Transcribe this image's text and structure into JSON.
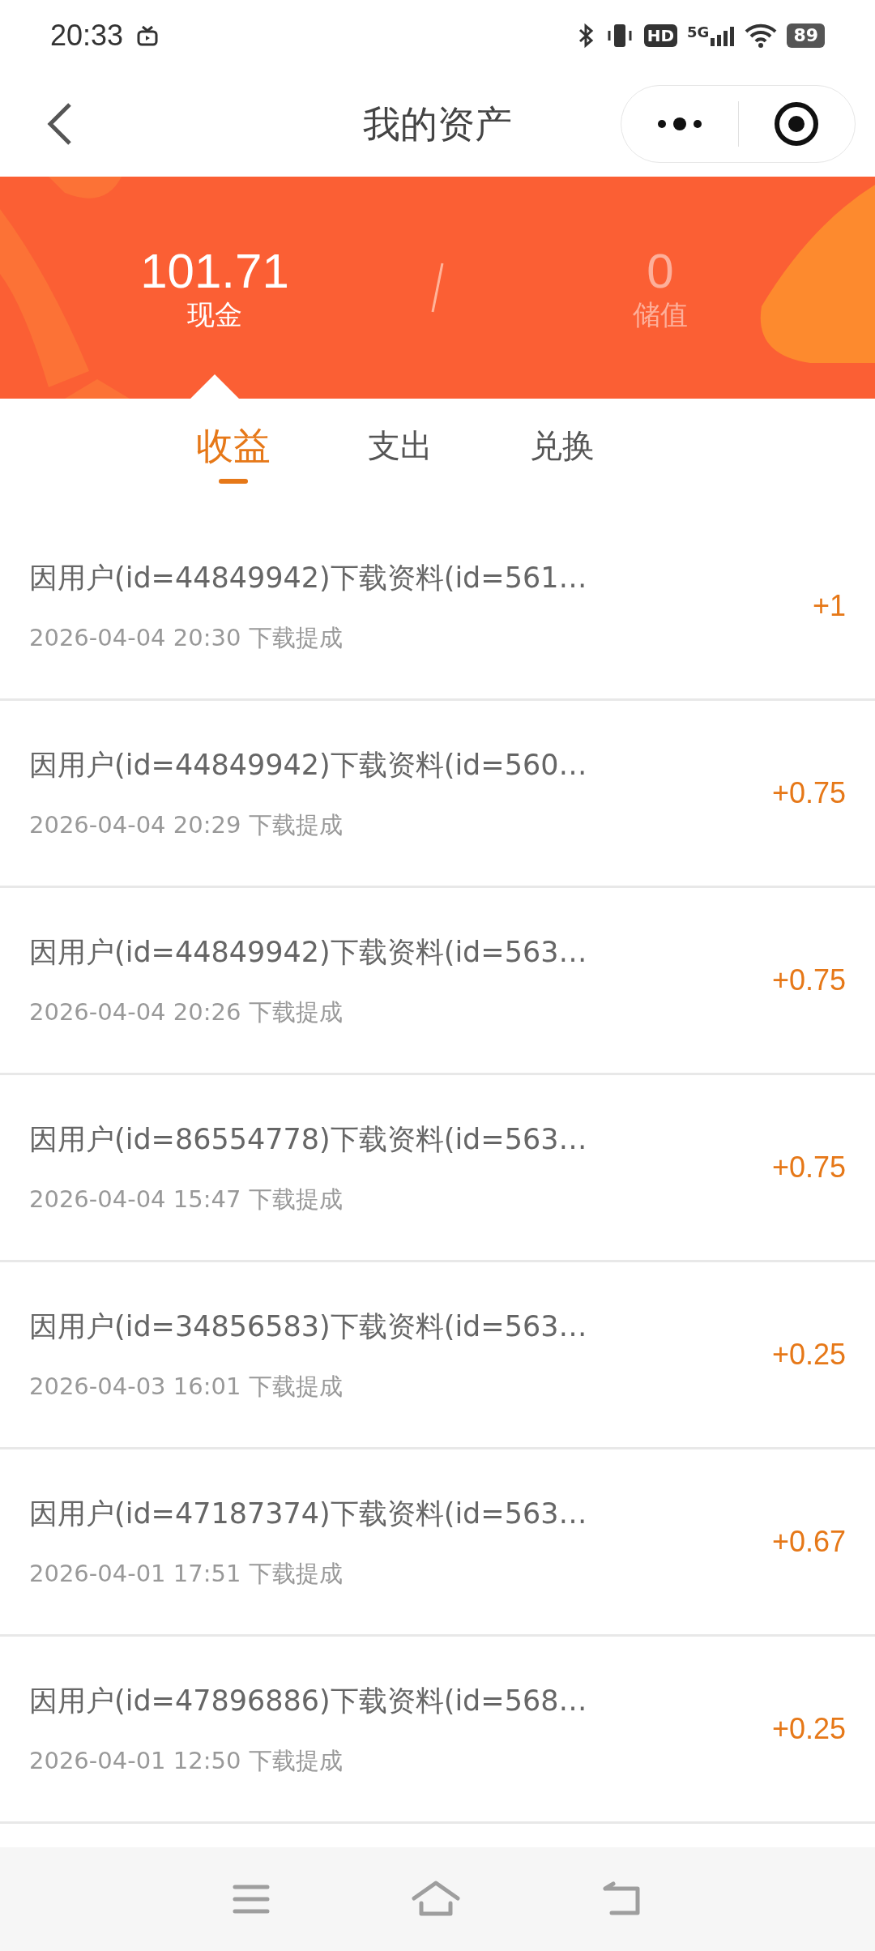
{
  "status_bar": {
    "time": "20:33",
    "hd": "HD",
    "network": "5G",
    "battery": "89"
  },
  "header": {
    "title": "我的资产"
  },
  "balances": [
    {
      "amount": "101.71",
      "label": "现金",
      "selected": true
    },
    {
      "amount": "0",
      "label": "储值",
      "selected": false
    }
  ],
  "tabs": [
    {
      "label": "收益",
      "selected": true
    },
    {
      "label": "支出",
      "selected": false
    },
    {
      "label": "兑换",
      "selected": false
    }
  ],
  "records": [
    {
      "title": "因用户(id=44849942)下载资料(id=561…",
      "time": "2026-04-04 20:30 下载提成",
      "amount": "+1"
    },
    {
      "title": "因用户(id=44849942)下载资料(id=560…",
      "time": "2026-04-04 20:29 下载提成",
      "amount": "+0.75"
    },
    {
      "title": "因用户(id=44849942)下载资料(id=563…",
      "time": "2026-04-04 20:26 下载提成",
      "amount": "+0.75"
    },
    {
      "title": "因用户(id=86554778)下载资料(id=563…",
      "time": "2026-04-04 15:47 下载提成",
      "amount": "+0.75"
    },
    {
      "title": "因用户(id=34856583)下载资料(id=563…",
      "time": "2026-04-03 16:01 下载提成",
      "amount": "+0.25"
    },
    {
      "title": "因用户(id=47187374)下载资料(id=563…",
      "time": "2026-04-01 17:51 下载提成",
      "amount": "+0.67"
    },
    {
      "title": "因用户(id=47896886)下载资料(id=568…",
      "time": "2026-04-01 12:50 下载提成",
      "amount": "+0.25"
    }
  ]
}
